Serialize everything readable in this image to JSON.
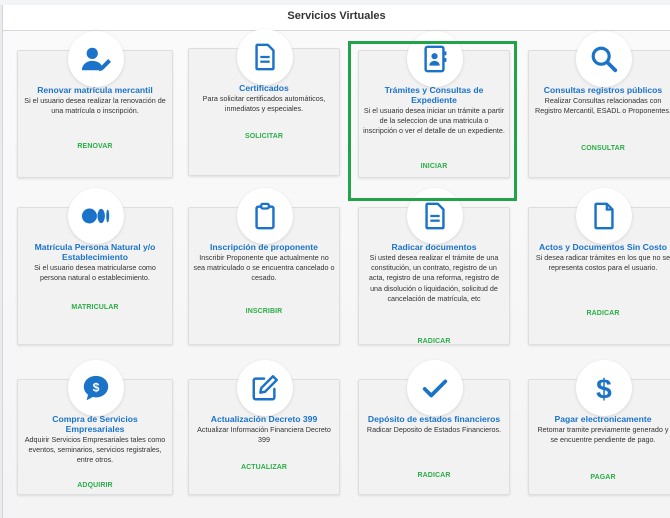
{
  "header": {
    "title": "Servicios Virtuales"
  },
  "colors": {
    "title_blue": "#1a73c9",
    "action_green": "#2bae48",
    "icon_blue": "#1a73c9",
    "highlight": "#22a34a"
  },
  "cards": [
    {
      "icon": "user-edit-icon",
      "title": "Renovar matrícula mercantil",
      "desc": "Si el usuario desea realizar la renovación de una matrícula o inscripción.",
      "action": "RENOVAR"
    },
    {
      "icon": "document-icon",
      "title": "Certificados",
      "desc": "Para solicitar certificados automáticos, inmediatos y especiales.",
      "action": "SOLICITAR"
    },
    {
      "icon": "address-book-icon",
      "title": "Trámites y Consultas de Expediente",
      "desc": "Si el usuario desea iniciar un trámite a partir de la seleccion de una matricula o inscripción o ver el detalle de un expediente.",
      "action": "INICIAR"
    },
    {
      "icon": "search-icon",
      "title": "Consultas registros públicos",
      "desc": "Realizar Consultas relacionadas con Registro Mercantil, ESADL o Proponentes.",
      "action": "CONSULTAR"
    },
    {
      "icon": "medium-logo-icon",
      "title": "Matrícula Persona Natural y/o Establecimiento",
      "desc": "Si el usuario desea matricularse como persona natural o establecimiento.",
      "action": "MATRICULAR"
    },
    {
      "icon": "clipboard-icon",
      "title": "Inscripción de proponente",
      "desc": "Inscribir Proponente que actualmente no sea matriculado o se encuentra cancelado o cesado.",
      "action": "INSCRIBIR"
    },
    {
      "icon": "document-icon",
      "title": "Radicar documentos",
      "desc": "Si usted desea realizar el trámite de una constitución, un contrato, registro de un acta, registro de una reforma, registro de una disolución o liquidación, solicitud de cancelación de matrícula, etc",
      "action": "RADICAR"
    },
    {
      "icon": "blank-file-icon",
      "title": "Actos y Documentos Sin Costo",
      "desc": "Si desea radicar trámites en los que no se representa costos para el usuario.",
      "action": "RADICAR"
    },
    {
      "icon": "dollar-chat-icon",
      "title": "Compra de Servicios Empresariales",
      "desc": "Adquirir Servicios Empresariales tales como eventos, seminarios, servicios registrales, entre otros.",
      "action": "ADQUIRIR"
    },
    {
      "icon": "edit-icon",
      "title": "Actualización Decreto 399",
      "desc": "Actualizar Información Financiera Decreto 399",
      "action": "ACTUALIZAR"
    },
    {
      "icon": "checkmark-icon",
      "title": "Depósito de estados financieros",
      "desc": "Radicar Deposito de Estados Financieros.",
      "action": "RADICAR"
    },
    {
      "icon": "dollar-icon",
      "title": "Pagar electronicamente",
      "desc": "Retomar tramite previamente generado y se encuentre pendiente de pago.",
      "action": "PAGAR"
    }
  ]
}
